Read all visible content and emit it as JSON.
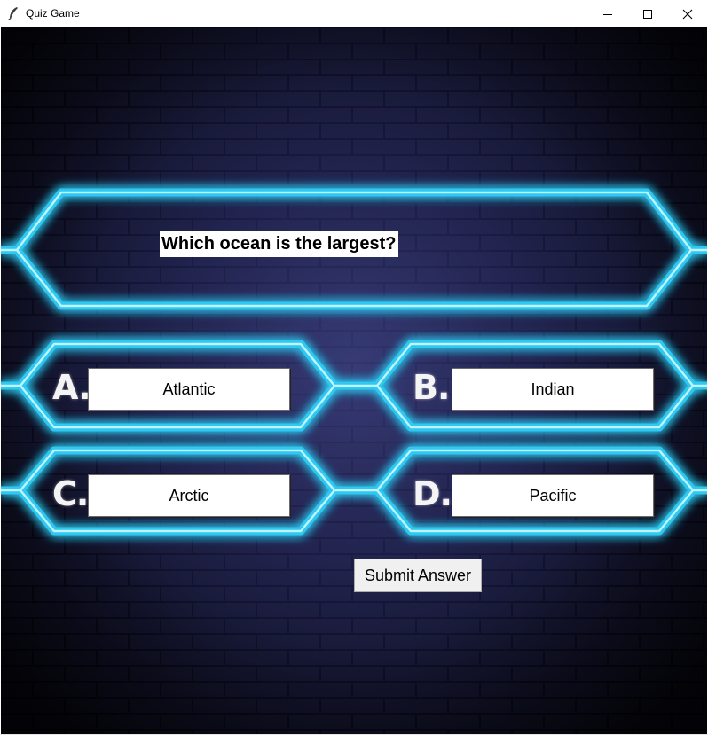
{
  "window": {
    "title": "Quiz Game",
    "controls": {
      "minimize": "minimize-icon",
      "maximize": "maximize-icon",
      "close": "close-icon"
    }
  },
  "quiz": {
    "question": "Which ocean is the largest?",
    "options": [
      {
        "letter": "A.",
        "label": "Atlantic"
      },
      {
        "letter": "B.",
        "label": "Indian"
      },
      {
        "letter": "C.",
        "label": "Arctic"
      },
      {
        "letter": "D.",
        "label": "Pacific"
      }
    ],
    "submit_label": "Submit Answer"
  },
  "theme": {
    "neon_color": "#34d6ff",
    "background_color": "#1f2150"
  }
}
